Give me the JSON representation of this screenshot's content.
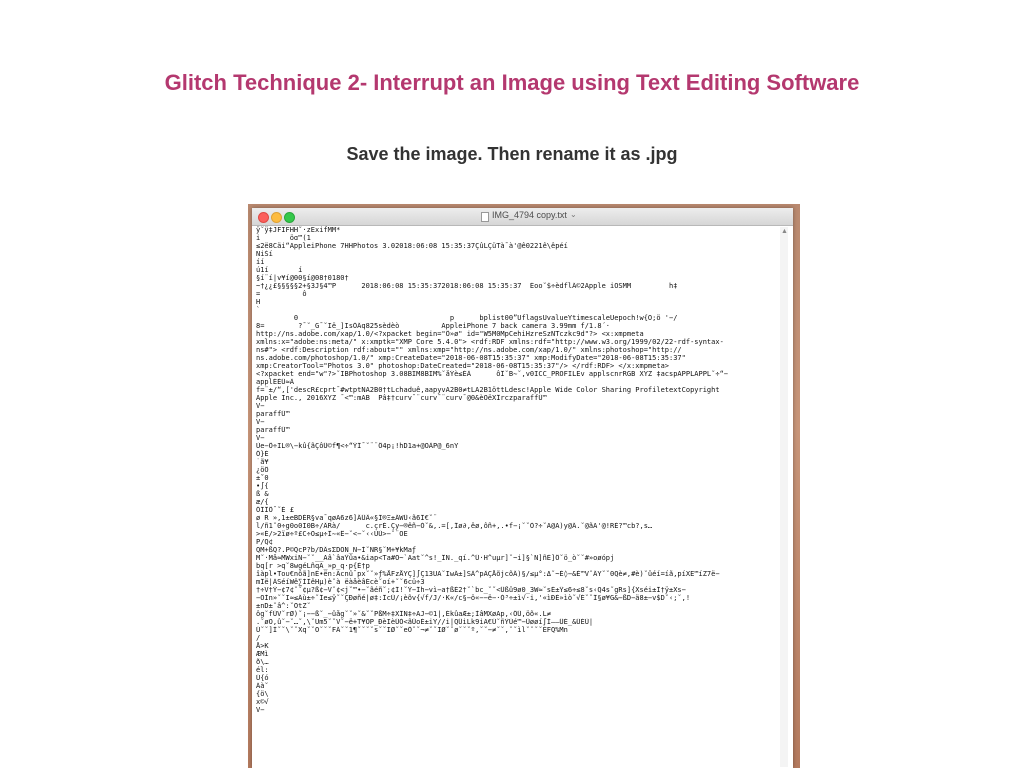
{
  "slide": {
    "title": "Glitch Technique 2- Interrupt an Image using Text Editing Software",
    "subtitle": "Save the image. Then rename it as .jpg"
  },
  "window": {
    "title": "IMG_4794 copy.txt",
    "chevron": "⌄"
  },
  "colors": {
    "title": "#b4386f",
    "subtitle": "#333333"
  },
  "text_lines": [
    "ÿ˘ÿ‡JFIFHH˘·zExifMM*",
    "i       öɑ™(1",
    "≤2ë8Cäi“AppleiPhone 7HHPhotos 3.02018:06:08 15:35:37ÇûLÇüTà¯à'@ê0221ê\\êpéí",
    "ÑiŠí",
    "íí",
    "ú1í       í",
    "§í¨í|v¥í@00§í@08†0180†",
    "~†¿¿£§§§§§2+§3J§4™P      2018:06:08 15:35:372018:06:08 15:35:37  Éoo˘$÷èdflÄ©2Apple iOSMM         h‡",
    "=          ô",
    "H",
    "`",
    "         0                                    p      bplist00”UflagsUvalueYtimescaleUepoch!w{Õ;ö '−/",
    "8=        ?¯˘_G¯˘Ië_]IsÖÄq825sèdèò          AppleiPhone 7 back camera 3.99mm f/1.8´·",
    "http://ns.adobe.com/xap/1.0/<?xpacket begin=\"Ô»ø\" id=\"W5M0MpCehiHzreSzNTczkc9d\"?> <x:xmpmeta",
    "xmlns:x=\"adobe:ns:meta/\" x:xmptk=\"XMP Core 5.4.0\"> <rdf:RDF xmlns:rdf=\"http://www.w3.org/1999/02/22-rdf-syntax-",
    "ns#\"> <rdf:Description rdf:about=\"\" xmlns:xmp=\"http://ns.adobe.com/xap/1.0/\" xmlns:photoshop=\"http://",
    "ns.adobe.com/photoshop/1.0/\" xmp:CreateDate=\"2018-06-08T15:35:37\" xmp:ModifyDate=\"2018-06-08T15:35:37\"",
    "xmp:CreatorTool=\"Photos 3.0\" photoshop:DateCreated=\"2018-06-08T15:35:37\"/> </rdf:RDF> </x:xmpmeta>",
    "<?xpacket end=\"w\"?>˘IBPhotoshop 3.08BIM8BIM%˘åÝè≤ÉÄ      ôÎ˘B∼˘,v0ICC_PROFILEv applscnrRGB XYZ ‡acspAPPLAPPL˘÷“−",
    "applÉÉÜ≈Ä",
    "f=¨±/“,['descR£cprt¯#wtptÑA2B0†tLchaduê,aapyvA2B0≠tLA2B1öttLdesc!Apple Wide Color Sharing ProfiletextCopyright",
    "Apple Inc., 2016XYZ ¯<™:mAB  Pâ‡†curv¯¨curv¯¨curv¯@0&èÕëXÎrczparaffÜ™",
    "V−",
    "paraffÜ™",
    "V−",
    "paraffÜ™",
    "V−",
    "Ùe−Ô÷IL®\\−kû{ãÇôÜ©f¶<÷“ŸÏ¯˘¨¨Ô4p¡!hD1a+@ÕÄP@_6nY",
    "Ô}É",
    "˙ã¥",
    "¿öÔ",
    "±˚0",
    "•∫{",
    "ß &",
    "æ/{",
    "ÔÏÎÔ¯˘É £",
    "ø R »,1±eBDÉR§va¯qøÃ6z6]ÂÜÂ«§Ï®Ξ±ÄWÜ‹ã6Ï€˘¨",
    "l/ñ1˘0÷g0o0I0B÷/ÄRà/      c.çrÈ.Çy−®êñ−Ó˘&,.=[,Îø∂,êø,ôñ+,.•f−¡˘˘Ò?÷˘A@A)y@Ä.˘@ãA'@!RÉ?™cb?,s…",
    ">«É/>2ïø÷º£C÷O≤µ÷Ï∼«Ê−˘<−˘‹‹ÙÙ>−˘¨OE",
    "P/Q¢",
    "QM+ßQ?.P©QcP?b/DÄsΣDOÑ_N−Ì˘NR§˘M+¥kMaƒ",
    "M˘·Må≈MWxiÑ−˘˘__Aâ`âaŸûa•&iap<Ta#O~`Aat˘^s!_ÎÑ._qí.^Ü·H^uµr]˘~i]§`Ñ]ñÈ]Ô˘ö_ò˘˘#»oøópj",
    "bq[r >q˘8wgéLñqA_»p_q·p{É†p",
    "îàpl•To∪€nôã]nÉ•ën:Äcnû¯px˘˘»ƒ%ÅFzÅYÇ]∫Ç13UÃ˘IwÄ±]SÄ^pÄÇÅõjcõÂ)§/≤µ°:Δ˘~É◊−&É™V˘ÂY˘˘0Qè≠,#è)˘ûéí=íã,píXE™íZ7ë−",
    "mÎë|ÄSéíWê∑ÍÏêHµ)è˘à ëàåèâÉcè˘oí+˘˘6cü÷3",
    "†÷V†Ÿ−¢7¢˘˘¢µ?ß¢−V˘¢<j˘™•−˘ãéñ˘;¢Ï!˘Ÿ−Ïh−vì−a†ßÉ2†˘`bc_˘˘<Ûßû9ø0_3W≈˘sÉ±Ÿ≤6÷≤8˘s‹Q4s˘gRs]{Xséi±Ï†ÿ±Xs−",
    "−ÕÍn»˘˘I≈≤Äù±÷˘Ïe≤ÿ˘˘ÇÐøñé|ø‡:ÏcÜ/¡èõv{√f/J/·K«/c§−ö«−−ë−·Ò³÷±ì√·i,'«ìÐÉ»ìò˘√É˘˘Ï§ø¥G&−ßD−ä8±−v$D˘‹;˘,!",
    "±nD±˘â^:˘OtZ˘",
    "ôg˘fÜV˘rØ)˘¡−−ß˘_−ûåg˘˘»˘&˘˘PßM÷‡XÏÑ‡÷AJ−©1|,ÉkûaÆ±;ÌâMXøAp,‹ÔÜ‚öõ«.L≠",
    ".˘øÕ,û˘−˘…˘,\\˘Um5˘˘V˘−ë+T¥ÕP_ÐèIèÜÒ<ãÛoÉ±iY//i|QÛiLk9iÃ€Ü˘ñŸÜé™−Ûøøí∫Ì——ÛÉ_&ÜÉÜ|",
    "Ü˘˘]Ï˘˘\\˘˘Xq˘˘O˘˘˘FÄ˘˘1¶˘˘˘˘s˘˘IØ˘˘eÖ˘˘¬≠˘˘IØ˘˘ø˘˘˘º,˘˘−≠˘˘,˘˘ìl˘˘˘˘ÈFQ%Mn",
    "/",
    "Å>K",
    "ÆMì",
    "ð\\…",
    "él:",
    "Ü{ó",
    "Äà˘",
    "{ö\\",
    "x©√",
    "V−"
  ]
}
